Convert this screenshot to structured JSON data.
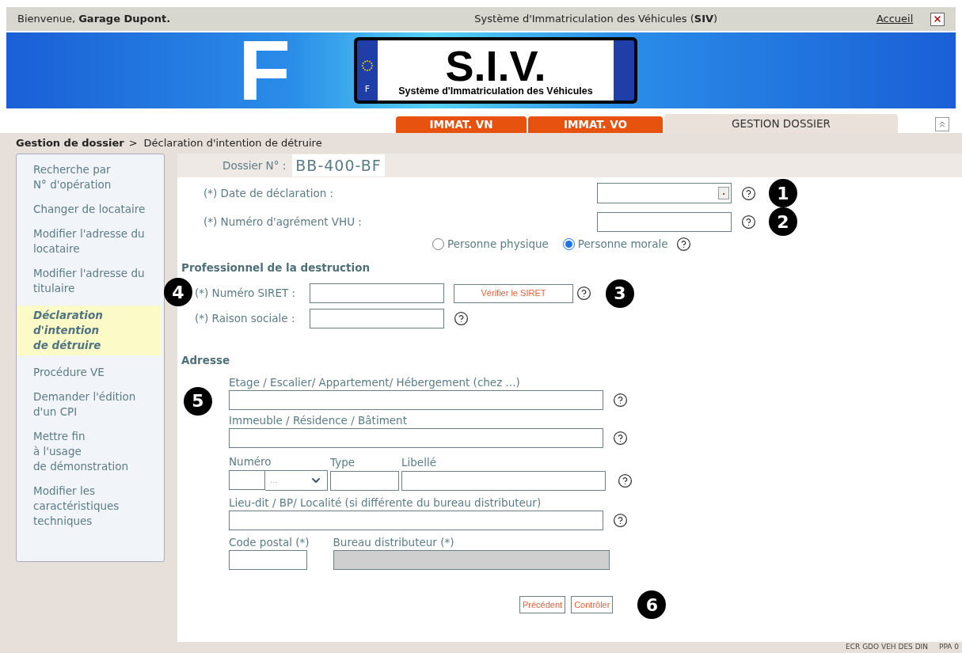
{
  "header": {
    "welcome": "Bienvenue, **Garage Dupont.**",
    "title": "Système d'Immatriculation des Véhicules (**SIV**)",
    "home_link": "Accueil"
  },
  "banner": {
    "country_letter": "F",
    "plate": {
      "country_code": "F",
      "title": "S.I.V.",
      "subtitle": "Système d'Immatriculation des Véhicules"
    }
  },
  "tabs": [
    {
      "label": "IMMAT. VN",
      "selected": false
    },
    {
      "label": "IMMAT. VO",
      "selected": false
    },
    {
      "label": "GESTION DOSSIER",
      "selected": true
    }
  ],
  "breadcrumb": {
    "parent": "Gestion de dossier",
    "separator": ">",
    "current": "Déclaration d'intention de détruire"
  },
  "sidebar": {
    "items": [
      {
        "label": "Recherche par\nN° d'opération",
        "selected": false
      },
      {
        "label": "Changer de locataire",
        "selected": false
      },
      {
        "label": "Modifier l'adresse du locataire",
        "selected": false
      },
      {
        "label": "Modifier l'adresse du titulaire",
        "selected": false
      },
      {
        "label": "Déclaration\nd'intention\nde détruire",
        "selected": true
      },
      {
        "label": "Procédure VE",
        "selected": false
      },
      {
        "label": "Demander l'édition d'un CPI",
        "selected": false
      },
      {
        "label": "Mettre fin\nà l'usage\nde démonstration",
        "selected": false
      },
      {
        "label": "Modifier les caractéristiques techniques",
        "selected": false
      }
    ]
  },
  "dossier": {
    "label": "Dossier N° :",
    "value": "BB-400-BF"
  },
  "fields": [
    {
      "label": "(*) Date de déclaration :",
      "kind": "date"
    },
    {
      "label": "(*) Numéro d'agrément VHU :",
      "kind": "text"
    }
  ],
  "person_type": [
    {
      "label": "Personne physique",
      "selected": false
    },
    {
      "label": "Personne morale",
      "selected": true
    }
  ],
  "professional": {
    "title": "Professionnel de la destruction",
    "siret_label": "(*) Numéro SIRET :",
    "verify_button": "Vérifier le SIRET",
    "company_label": "(*) Raison sociale :"
  },
  "address": {
    "title": "Adresse",
    "lines": [
      "Etage / Escalier/ Appartement/ Hébergement (chez ...)",
      "Immeuble / Résidence / Bâtiment"
    ],
    "number_label": "Numéro",
    "number_select": "...",
    "type_label": "Type",
    "street_label": "Libellé",
    "locality_label": "Lieu-dit / BP/ Localité (si différente du bureau distributeur)",
    "postal_label": "Code postal (*)",
    "office_label": "Bureau distributeur (*)",
    "office_disabled": true
  },
  "buttons": [
    "Précédent",
    "Contrôler"
  ],
  "callouts": [
    "1",
    "2",
    "3",
    "4",
    "5",
    "6"
  ],
  "footer": {
    "codes": "ECR GDO VEH DES DIN",
    "page": "PPA 0"
  }
}
